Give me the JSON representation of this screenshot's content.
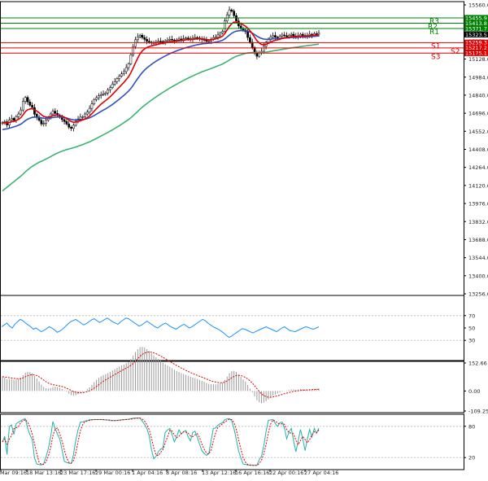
{
  "chart_data": [
    {
      "panel": "price",
      "type": "candlestick",
      "title": "",
      "ylim": [
        13256,
        15560
      ],
      "y_ticks": [
        "15560.0",
        "15416.0",
        "15272.0",
        "15128.0",
        "14984.0",
        "14840.0",
        "14696.0",
        "14552.0",
        "14408.0",
        "14264.0",
        "14120.0",
        "13976.0",
        "13832.0",
        "13688.0",
        "13544.0",
        "13400.0",
        "13256.0"
      ],
      "x_ticks": [
        "Mar 09:16",
        "18 Mar 13:16",
        "23 Mar 17:16",
        "29 Mar 00:16",
        "1 Apr 04:16",
        "8 Apr 08:16",
        "13 Apr 12:16",
        "16 Apr 16:16",
        "22 Apr 00:16",
        "27 Apr 04:16"
      ],
      "close": [
        14620,
        14628,
        14602,
        14642,
        14655,
        14640,
        14668,
        14690,
        14722,
        14790,
        14822,
        14786,
        14760,
        14742,
        14688,
        14665,
        14640,
        14610,
        14615,
        14640,
        14662,
        14690,
        14712,
        14695,
        14680,
        14668,
        14645,
        14630,
        14610,
        14585,
        14575,
        14600,
        14632,
        14650,
        14665,
        14668,
        14690,
        14705,
        14735,
        14770,
        14805,
        14820,
        14836,
        14845,
        14850,
        14858,
        14882,
        14900,
        14928,
        14948,
        14972,
        14992,
        15010,
        15028,
        15060,
        15090,
        15162,
        15228,
        15282,
        15305,
        15318,
        15300,
        15285,
        15270,
        15262,
        15256,
        15258,
        15262,
        15270,
        15268,
        15264,
        15272,
        15280,
        15286,
        15280,
        15274,
        15280,
        15288,
        15284,
        15290,
        15296,
        15290,
        15286,
        15294,
        15300,
        15296,
        15290,
        15286,
        15278,
        15270,
        15272,
        15286,
        15300,
        15302,
        15320,
        15336,
        15348,
        15432,
        15480,
        15520,
        15510,
        15474,
        15432,
        15392,
        15372,
        15360,
        15346,
        15300,
        15262,
        15220,
        15180,
        15150,
        15176,
        15190,
        15230,
        15262,
        15284,
        15304,
        15316,
        15302,
        15296,
        15310,
        15320,
        15314,
        15306,
        15318,
        15326,
        15312,
        15300,
        15314,
        15326,
        15316,
        15304,
        15316,
        15326,
        15318,
        15330,
        15326,
        15336
      ],
      "resistance": [
        {
          "name": "R3",
          "value": 15455.9,
          "label": "15455.9"
        },
        {
          "name": "R2",
          "value": 15413.8,
          "label": "15413.8"
        },
        {
          "name": "R1",
          "value": 15371.7,
          "label": "15371.7"
        }
      ],
      "last_price": {
        "value": 15323.5,
        "label": "15323.5"
      },
      "support": [
        {
          "name": "S1",
          "value": 15259.3,
          "label": "15259.3"
        },
        {
          "name": "S2",
          "value": 15217.2,
          "label": "15217.2"
        },
        {
          "name": "S3",
          "value": 15175.1,
          "label": "15175.1"
        }
      ],
      "colors": {
        "resistance": "#008000",
        "support": "#e00000",
        "ma_fast": "#e00000",
        "ma_mid": "#3050c0",
        "ma_slow": "#3cb371",
        "candle": "#000000",
        "last_tag": "#000000"
      }
    },
    {
      "panel": "rsi",
      "type": "line",
      "ylim": [
        0,
        100
      ],
      "y_ticks": [
        "70",
        "50",
        "30"
      ],
      "levels": [
        70,
        30
      ],
      "values": [
        52,
        55,
        58,
        53,
        50,
        56,
        60,
        64,
        62,
        58,
        55,
        52,
        48,
        50,
        47,
        44,
        46,
        49,
        52,
        50,
        47,
        43,
        45,
        48,
        52,
        56,
        60,
        62,
        64,
        61,
        58,
        55,
        57,
        60,
        63,
        65,
        62,
        59,
        61,
        64,
        66,
        63,
        60,
        58,
        56,
        60,
        63,
        66,
        65,
        62,
        59,
        56,
        53,
        55,
        58,
        61,
        58,
        55,
        52,
        50,
        53,
        56,
        58,
        55,
        52,
        50,
        48,
        51,
        54,
        56,
        53,
        50,
        52,
        55,
        58,
        61,
        64,
        62,
        58,
        55,
        52,
        50,
        48,
        45,
        42,
        38,
        35,
        37,
        40,
        43,
        46,
        49,
        48,
        46,
        44,
        42,
        44,
        46,
        48,
        50,
        52,
        50,
        48,
        46,
        44,
        47,
        50,
        52,
        49,
        46,
        45,
        44,
        46,
        48,
        50,
        52,
        51,
        49,
        48,
        50,
        52
      ]
    },
    {
      "panel": "macd",
      "type": "bar",
      "ylim": [
        -109.25,
        152.66
      ],
      "y_ticks": [
        "152.66",
        "0.00",
        "-109.25"
      ]
    },
    {
      "panel": "stochastic",
      "type": "line",
      "ylim": [
        0,
        100
      ],
      "y_ticks": [
        "80",
        "20"
      ],
      "levels": [
        80,
        20
      ]
    }
  ]
}
